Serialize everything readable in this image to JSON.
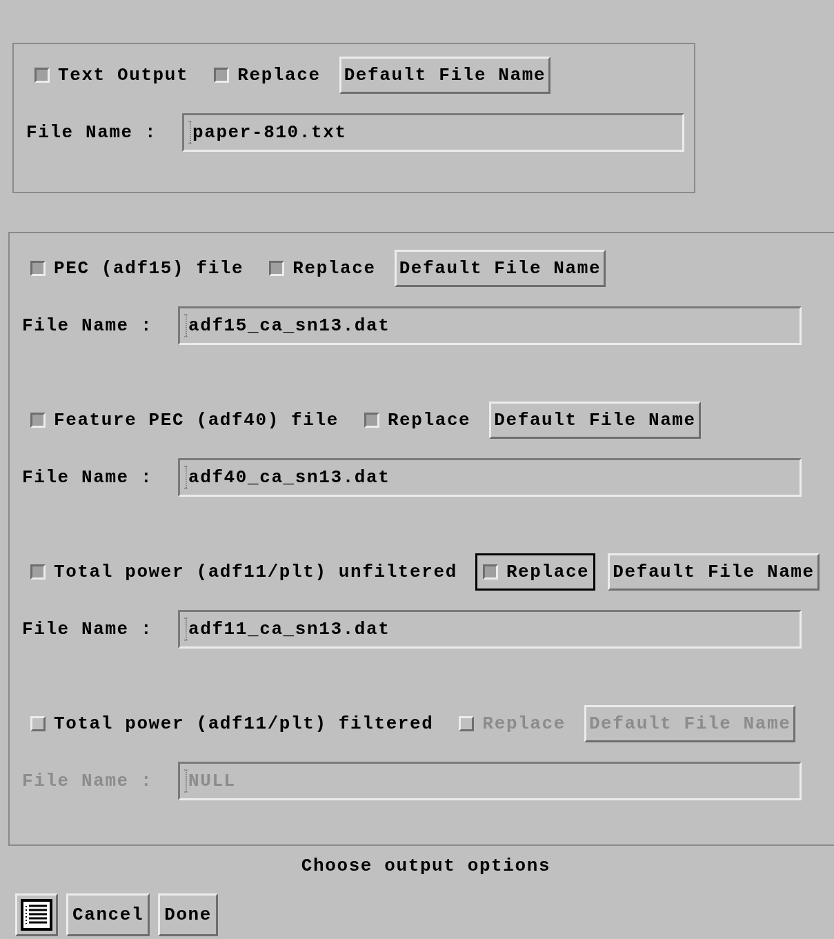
{
  "groups": [
    {
      "sections": [
        {
          "option": {
            "label": "Text Output",
            "checked": true
          },
          "replace": {
            "label": "Replace",
            "checked": true,
            "disabled": false,
            "focused": false
          },
          "default_button": {
            "label": "Default File Name",
            "disabled": false
          },
          "file_label": "File Name :",
          "file_name": {
            "value": "paper-810.txt",
            "disabled": false
          }
        }
      ]
    },
    {
      "sections": [
        {
          "option": {
            "label": "PEC (adf15) file",
            "checked": true
          },
          "replace": {
            "label": "Replace",
            "checked": true,
            "disabled": false,
            "focused": false
          },
          "default_button": {
            "label": "Default File Name",
            "disabled": false
          },
          "file_label": "File Name :",
          "file_name": {
            "value": "adf15_ca_sn13.dat",
            "disabled": false
          }
        },
        {
          "option": {
            "label": "Feature PEC (adf40) file",
            "checked": true
          },
          "replace": {
            "label": "Replace",
            "checked": true,
            "disabled": false,
            "focused": false
          },
          "default_button": {
            "label": "Default File Name",
            "disabled": false
          },
          "file_label": "File Name :",
          "file_name": {
            "value": "adf40_ca_sn13.dat",
            "disabled": false
          }
        },
        {
          "option": {
            "label": "Total power (adf11/plt) unfiltered",
            "checked": true
          },
          "replace": {
            "label": "Replace",
            "checked": true,
            "disabled": false,
            "focused": true
          },
          "default_button": {
            "label": "Default File Name",
            "disabled": false
          },
          "file_label": "File Name :",
          "file_name": {
            "value": "adf11_ca_sn13.dat",
            "disabled": false
          }
        },
        {
          "option": {
            "label": "Total power (adf11/plt) filtered",
            "checked": false
          },
          "replace": {
            "label": "Replace",
            "checked": false,
            "disabled": true,
            "focused": false
          },
          "default_button": {
            "label": "Default File Name",
            "disabled": true
          },
          "file_label": "File Name :",
          "file_name": {
            "value": "NULL",
            "disabled": true
          }
        }
      ]
    }
  ],
  "footer": {
    "message": "Choose output options",
    "buttons": [
      "Cancel",
      "Done"
    ]
  }
}
